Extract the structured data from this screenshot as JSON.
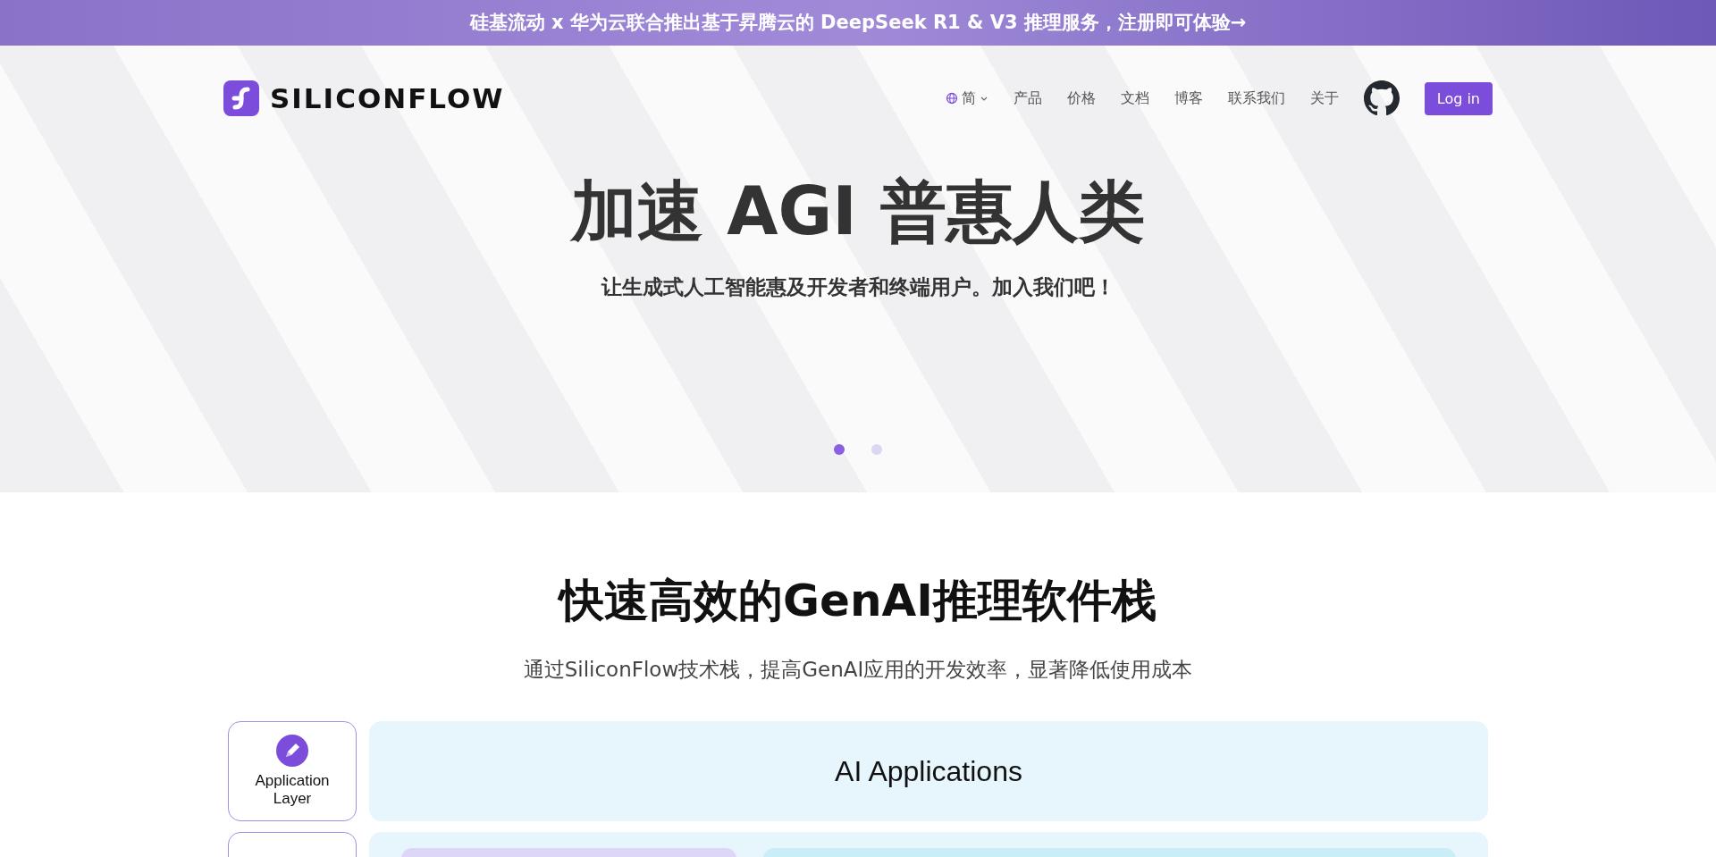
{
  "banner": {
    "text": "硅基流动 x 华为云联合推出基于昇腾云的 DeepSeek R1 & V3 推理服务，注册即可体验→"
  },
  "header": {
    "logo_text": "SILICONFLOW",
    "language": "简",
    "nav": [
      "产品",
      "价格",
      "文档",
      "博客",
      "联系我们",
      "关于"
    ],
    "login": "Log in"
  },
  "hero": {
    "title": "加速 AGI 普惠人类",
    "subtitle": "让生成式人工智能惠及开发者和终端用户。加入我们吧！",
    "slides": [
      {
        "selected": true
      },
      {
        "selected": false
      }
    ]
  },
  "stack": {
    "title": "快速高效的GenAI推理软件栈",
    "subtitle": "通过SiliconFlow技术栈，提高GenAI应用的开发效率，显著降低使用成本",
    "layers": [
      {
        "kind": "text",
        "label": "Application Layer",
        "content": "AI Applications"
      },
      {
        "kind": "blocks"
      }
    ]
  }
}
